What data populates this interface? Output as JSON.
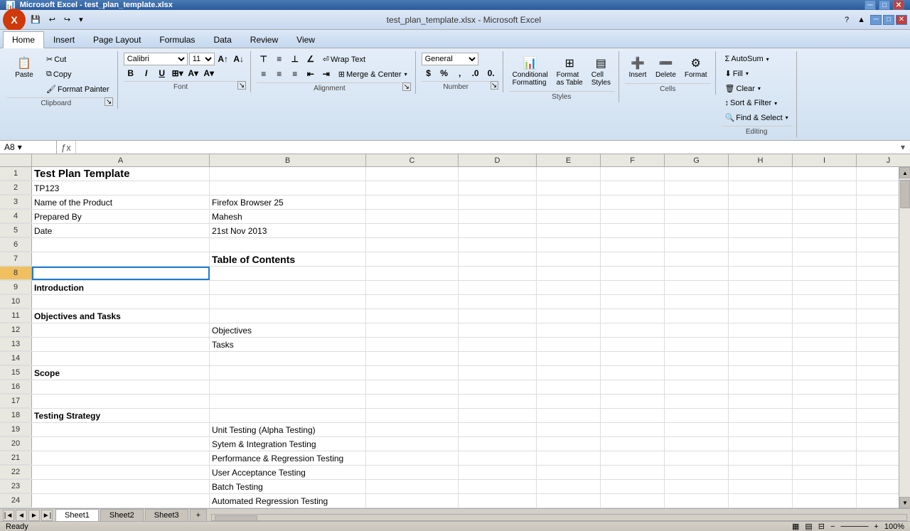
{
  "titleBar": {
    "title": "Microsoft Excel - test_plan_template.xlsx",
    "appIcon": "📊"
  },
  "quickAccess": {
    "buttons": [
      "💾",
      "↩",
      "↪",
      "▾"
    ]
  },
  "ribbon": {
    "tabs": [
      "Home",
      "Insert",
      "Page Layout",
      "Formulas",
      "Data",
      "Review",
      "View"
    ],
    "activeTab": "Home",
    "groups": {
      "clipboard": {
        "label": "Clipboard",
        "pasteLabel": "Paste",
        "cutLabel": "Cut",
        "copyLabel": "Copy",
        "formatPainterLabel": "Format Painter"
      },
      "font": {
        "label": "Font",
        "fontName": "Calibri",
        "fontSize": "11",
        "boldLabel": "B",
        "italicLabel": "I",
        "underlineLabel": "U"
      },
      "alignment": {
        "label": "Alignment",
        "wrapText": "Wrap Text",
        "mergeCenter": "Merge & Center"
      },
      "number": {
        "label": "Number",
        "format": "General"
      },
      "styles": {
        "label": "Styles",
        "conditionalFormatting": "Conditional Formatting",
        "formatAsTable": "Format as Table",
        "cellStyles": "Cell Styles"
      },
      "cells": {
        "label": "Cells",
        "insert": "Insert",
        "delete": "Delete",
        "format": "Format"
      },
      "editing": {
        "label": "Editing",
        "autoSum": "AutoSum",
        "fill": "Fill",
        "clear": "Clear",
        "sortFilter": "Sort & Filter",
        "findSelect": "Find & Select"
      }
    }
  },
  "formulaBar": {
    "cellRef": "A8",
    "formula": ""
  },
  "columns": [
    "A",
    "B",
    "C",
    "D",
    "E",
    "F",
    "G",
    "H",
    "I",
    "J"
  ],
  "rows": [
    {
      "num": 1,
      "cells": [
        "Test Plan Template",
        "",
        "",
        "",
        "",
        "",
        "",
        "",
        "",
        ""
      ]
    },
    {
      "num": 2,
      "cells": [
        "TP123",
        "",
        "",
        "",
        "",
        "",
        "",
        "",
        "",
        ""
      ]
    },
    {
      "num": 3,
      "cells": [
        "Name of the Product",
        "Firefox Browser 25",
        "",
        "",
        "",
        "",
        "",
        "",
        "",
        ""
      ]
    },
    {
      "num": 4,
      "cells": [
        "Prepared By",
        "Mahesh",
        "",
        "",
        "",
        "",
        "",
        "",
        "",
        ""
      ]
    },
    {
      "num": 5,
      "cells": [
        "Date",
        "21st Nov 2013",
        "",
        "",
        "",
        "",
        "",
        "",
        "",
        ""
      ]
    },
    {
      "num": 6,
      "cells": [
        "",
        "",
        "",
        "",
        "",
        "",
        "",
        "",
        "",
        ""
      ]
    },
    {
      "num": 7,
      "cells": [
        "",
        "Table of Contents",
        "",
        "",
        "",
        "",
        "",
        "",
        "",
        ""
      ]
    },
    {
      "num": 8,
      "cells": [
        "",
        "",
        "",
        "",
        "",
        "",
        "",
        "",
        "",
        ""
      ]
    },
    {
      "num": 9,
      "cells": [
        "Introduction",
        "",
        "",
        "",
        "",
        "",
        "",
        "",
        "",
        ""
      ]
    },
    {
      "num": 10,
      "cells": [
        "",
        "",
        "",
        "",
        "",
        "",
        "",
        "",
        "",
        ""
      ]
    },
    {
      "num": 11,
      "cells": [
        "Objectives and Tasks",
        "",
        "",
        "",
        "",
        "",
        "",
        "",
        "",
        ""
      ]
    },
    {
      "num": 12,
      "cells": [
        "",
        "Objectives",
        "",
        "",
        "",
        "",
        "",
        "",
        "",
        ""
      ]
    },
    {
      "num": 13,
      "cells": [
        "",
        "Tasks",
        "",
        "",
        "",
        "",
        "",
        "",
        "",
        ""
      ]
    },
    {
      "num": 14,
      "cells": [
        "",
        "",
        "",
        "",
        "",
        "",
        "",
        "",
        "",
        ""
      ]
    },
    {
      "num": 15,
      "cells": [
        "Scope",
        "",
        "",
        "",
        "",
        "",
        "",
        "",
        "",
        ""
      ]
    },
    {
      "num": 16,
      "cells": [
        "",
        "",
        "",
        "",
        "",
        "",
        "",
        "",
        "",
        ""
      ]
    },
    {
      "num": 17,
      "cells": [
        "",
        "",
        "",
        "",
        "",
        "",
        "",
        "",
        "",
        ""
      ]
    },
    {
      "num": 18,
      "cells": [
        "Testing Strategy",
        "",
        "",
        "",
        "",
        "",
        "",
        "",
        "",
        ""
      ]
    },
    {
      "num": 19,
      "cells": [
        "",
        "Unit Testing (Alpha Testing)",
        "",
        "",
        "",
        "",
        "",
        "",
        "",
        ""
      ]
    },
    {
      "num": 20,
      "cells": [
        "",
        "Sytem & Integration Testing",
        "",
        "",
        "",
        "",
        "",
        "",
        "",
        ""
      ]
    },
    {
      "num": 21,
      "cells": [
        "",
        "Performance & Regression Testing",
        "",
        "",
        "",
        "",
        "",
        "",
        "",
        ""
      ]
    },
    {
      "num": 22,
      "cells": [
        "",
        "User Acceptance Testing",
        "",
        "",
        "",
        "",
        "",
        "",
        "",
        ""
      ]
    },
    {
      "num": 23,
      "cells": [
        "",
        "Batch Testing",
        "",
        "",
        "",
        "",
        "",
        "",
        "",
        ""
      ]
    },
    {
      "num": 24,
      "cells": [
        "",
        "Automated Regression Testing",
        "",
        "",
        "",
        "",
        "",
        "",
        "",
        ""
      ]
    }
  ],
  "sheets": [
    "Sheet1",
    "Sheet2",
    "Sheet3"
  ],
  "activeSheet": "Sheet1",
  "statusBar": {
    "status": "Ready",
    "zoom": "100%"
  },
  "specialCells": {
    "row1col0": "bold-large",
    "row7col1": "bold",
    "row9col0": "bold",
    "row11col0": "bold",
    "row15col0": "bold",
    "row18col0": "bold"
  }
}
